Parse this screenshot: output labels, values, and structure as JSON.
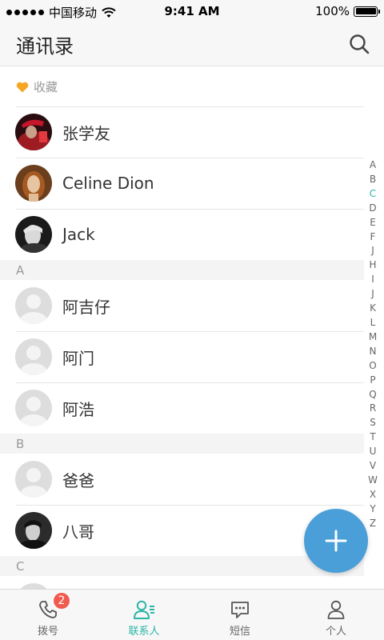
{
  "status_bar": {
    "carrier": "中国移动",
    "time": "9:41 AM",
    "battery_percent": "100%",
    "battery_level": 1.0
  },
  "header": {
    "title": "通讯录",
    "search_icon": "search-icon"
  },
  "favorites": {
    "label": "收藏",
    "icon": "heart-icon",
    "icon_color": "#f5a623",
    "contacts": [
      {
        "name": "张学友"
      },
      {
        "name": "Celine Dion"
      },
      {
        "name": "Jack"
      }
    ]
  },
  "sections": [
    {
      "letter": "A",
      "contacts": [
        {
          "name": "阿吉仔"
        },
        {
          "name": "阿门"
        },
        {
          "name": "阿浩"
        }
      ]
    },
    {
      "letter": "B",
      "contacts": [
        {
          "name": "爸爸"
        },
        {
          "name": "八哥"
        }
      ]
    },
    {
      "letter": "C",
      "contacts": []
    }
  ],
  "index_letters": [
    "A",
    "B",
    "C",
    "D",
    "E",
    "F",
    "J",
    "H",
    "I",
    "J",
    "K",
    "L",
    "M",
    "N",
    "O",
    "P",
    "Q",
    "R",
    "S",
    "T",
    "U",
    "V",
    "W",
    "X",
    "Y",
    "Z"
  ],
  "index_active": "C",
  "fab": {
    "icon": "plus-icon",
    "color": "#4a9fd8"
  },
  "tabs": [
    {
      "label": "拨号",
      "icon": "phone-icon",
      "badge": "2"
    },
    {
      "label": "联系人",
      "icon": "contacts-icon",
      "active": true
    },
    {
      "label": "短信",
      "icon": "message-icon"
    },
    {
      "label": "个人",
      "icon": "user-icon"
    }
  ],
  "colors": {
    "accent": "#2bb5a7",
    "badge": "#f05a4f"
  }
}
